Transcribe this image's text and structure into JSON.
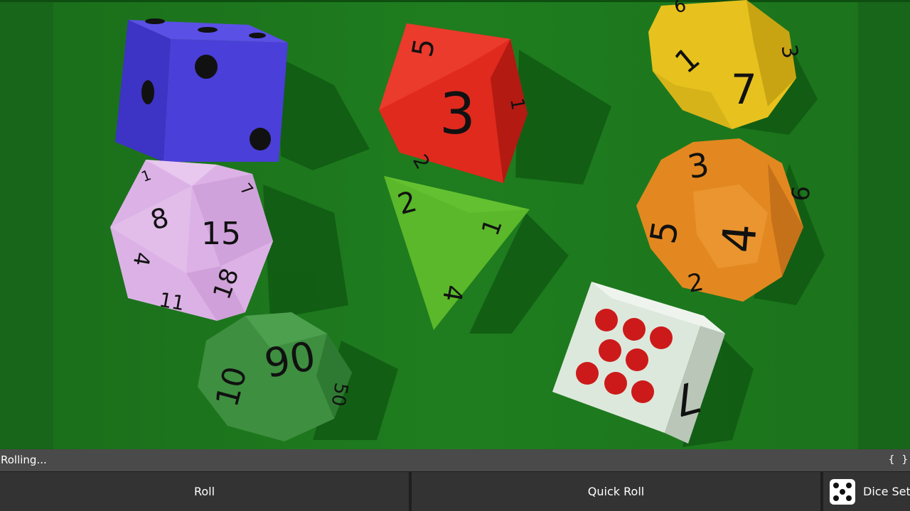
{
  "status": {
    "text": "Rolling...",
    "json_toggle": "{ }"
  },
  "buttons": {
    "roll": "Roll",
    "quick_roll": "Quick Roll",
    "dice_set": "Dice Set"
  },
  "icons": {
    "dice_set": "five-pip-die-icon"
  },
  "colors": {
    "felt": "#1e7a1e",
    "felt_dark": "#135e13",
    "status_bar": "#4a4a4a",
    "button": "#333333"
  },
  "dice": {
    "d6_blue": {
      "color": "#4a3fd8",
      "faces": [
        "pips-2",
        "pips-3",
        "pips-1"
      ]
    },
    "d8_red": {
      "color": "#e02a1e",
      "labels": [
        "5",
        "3",
        "1",
        "2"
      ]
    },
    "d12_yellow": {
      "color": "#e7c21e",
      "labels": [
        "6",
        "1",
        "7",
        "3"
      ]
    },
    "d20_pink": {
      "color": "#dcb2e6",
      "labels": [
        "1",
        "8",
        "15",
        "7",
        "4",
        "18",
        "11"
      ]
    },
    "d4_green": {
      "color": "#5ab82a",
      "labels": [
        "2",
        "1",
        "4"
      ]
    },
    "d12_orange": {
      "color": "#e38820",
      "labels": [
        "3",
        "5",
        "4",
        "9",
        "2"
      ]
    },
    "d10_green": {
      "color": "#3e8f40",
      "labels": [
        "90",
        "10",
        "50"
      ]
    },
    "d6_white": {
      "color": "#dde8dc",
      "pip_color": "#cc1a1a",
      "labels": [
        "7"
      ]
    }
  }
}
